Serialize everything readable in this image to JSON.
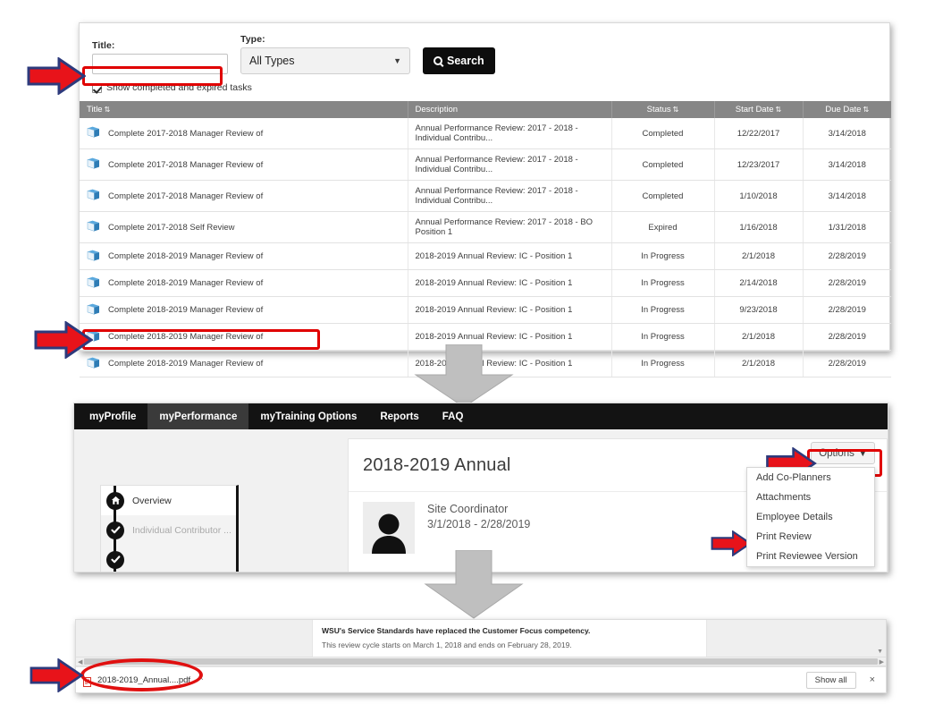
{
  "search_panel": {
    "title_label": "Title:",
    "title_value": "",
    "title_placeholder": "",
    "type_label": "Type:",
    "type_value": "All Types",
    "type_options": [
      "All Types"
    ],
    "search_button": "Search",
    "checkbox_label": "Show completed and expired tasks",
    "checkbox_checked": true
  },
  "table": {
    "columns": [
      "Title",
      "Description",
      "Status",
      "Start Date",
      "Due Date"
    ],
    "rows": [
      {
        "title": "Complete 2017-2018 Manager Review of",
        "description": "Annual Performance Review: 2017 - 2018 - Individual Contribu...",
        "status": "Completed",
        "start": "12/22/2017",
        "due": "3/14/2018"
      },
      {
        "title": "Complete 2017-2018 Manager Review of",
        "description": "Annual Performance Review: 2017 - 2018 - Individual Contribu...",
        "status": "Completed",
        "start": "12/23/2017",
        "due": "3/14/2018"
      },
      {
        "title": "Complete 2017-2018 Manager Review of",
        "description": "Annual Performance Review: 2017 - 2018 - Individual Contribu...",
        "status": "Completed",
        "start": "1/10/2018",
        "due": "3/14/2018"
      },
      {
        "title": "Complete 2017-2018 Self Review",
        "description": "Annual Performance Review: 2017 - 2018 - BO Position 1",
        "status": "Expired",
        "start": "1/16/2018",
        "due": "1/31/2018"
      },
      {
        "title": "Complete 2018-2019 Manager Review of",
        "description": "2018-2019 Annual Review: IC - Position 1",
        "status": "In Progress",
        "start": "2/1/2018",
        "due": "2/28/2019"
      },
      {
        "title": "Complete 2018-2019 Manager Review of",
        "description": "2018-2019 Annual Review: IC - Position 1",
        "status": "In Progress",
        "start": "2/14/2018",
        "due": "2/28/2019"
      },
      {
        "title": "Complete 2018-2019 Manager Review of",
        "description": "2018-2019 Annual Review: IC - Position 1",
        "status": "In Progress",
        "start": "9/23/2018",
        "due": "2/28/2019"
      },
      {
        "title": "Complete 2018-2019 Manager Review of",
        "description": "2018-2019 Annual Review: IC - Position 1",
        "status": "In Progress",
        "start": "2/1/2018",
        "due": "2/28/2019"
      },
      {
        "title": "Complete 2018-2019 Manager Review of",
        "description": "2018-2019 Annual Review: IC - Position 1",
        "status": "In Progress",
        "start": "2/1/2018",
        "due": "2/28/2019"
      }
    ]
  },
  "nav": {
    "items": [
      {
        "label": "myProfile",
        "active": false
      },
      {
        "label": "myPerformance",
        "active": true
      },
      {
        "label": "myTraining Options",
        "active": false
      },
      {
        "label": "Reports",
        "active": false
      },
      {
        "label": "FAQ",
        "active": false
      }
    ]
  },
  "review_page": {
    "heading": "2018-2019 Annual",
    "person_name": "Site Coordinator",
    "person_dates": "3/1/2018 - 2/28/2019",
    "options_button": "Options",
    "options_menu": [
      "Add Co-Planners",
      "Attachments",
      "Employee Details",
      "Print Review",
      "Print Reviewee Version"
    ],
    "rail": [
      {
        "label": "Overview",
        "icon": "home-icon",
        "selected": true
      },
      {
        "label": "Individual Contributor ...",
        "icon": "check-icon",
        "selected": false
      }
    ]
  },
  "document": {
    "line1": "WSU's Service Standards have replaced the Customer Focus competency.",
    "line2": "This review cycle starts on March 1, 2018 and ends on February 28, 2019."
  },
  "download_bar": {
    "file_name": "2018-2019_Annual....pdf",
    "show_all": "Show all",
    "close": "×"
  },
  "annotations": {
    "arrow_color": "#E8131A",
    "arrow_outline": "#2D3A7C",
    "highlight_color": "#E00000",
    "gray_arrow_color": "#BFBFBF"
  }
}
